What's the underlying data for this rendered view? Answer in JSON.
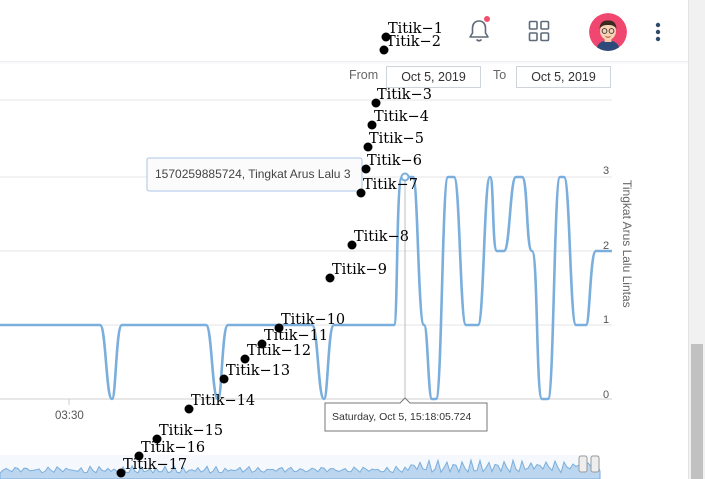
{
  "header": {
    "icons": [
      "bell-icon",
      "grid-icon",
      "avatar",
      "more-vertical-icon"
    ],
    "colors": {
      "notification_dot": "#f0506e",
      "avatar_bg": "#ef476f"
    }
  },
  "date_range": {
    "from_label": "From",
    "from_value": "Oct 5, 2019",
    "to_label": "To",
    "to_value": "Oct 5, 2019"
  },
  "chart": {
    "y_axis_label": "Tingkat Arus Lalu Lintas",
    "y_ticks": [
      "0",
      "1",
      "2",
      "3"
    ],
    "x_tick": "03:30",
    "tooltip_top": "1570259885724, Tingkat Arus Lalu 3",
    "tooltip_bottom": "Saturday, Oct 5, 15:18:05.724",
    "line_color": "#7aaedc"
  },
  "chart_data": {
    "type": "line",
    "series": [
      {
        "name": "Tingkat Arus Lalu Lintas",
        "values": [
          1,
          1,
          0,
          1,
          1,
          0,
          1,
          1,
          0,
          1,
          1,
          0,
          1,
          1,
          0,
          1,
          3,
          3,
          1,
          0,
          3,
          3,
          1,
          3,
          2,
          2,
          3,
          3,
          2,
          2,
          3,
          3,
          0,
          3,
          3,
          1,
          1,
          2,
          2
        ]
      }
    ],
    "ylim": [
      0,
      3
    ]
  },
  "points": [
    {
      "label": "Titik−1"
    },
    {
      "label": "Titik−2"
    },
    {
      "label": "Titik−3"
    },
    {
      "label": "Titik−4"
    },
    {
      "label": "Titik−5"
    },
    {
      "label": "Titik−6"
    },
    {
      "label": "Titik−7"
    },
    {
      "label": "Titik−8"
    },
    {
      "label": "Titik−9"
    },
    {
      "label": "Titik−10"
    },
    {
      "label": "Titik−11"
    },
    {
      "label": "Titik−12"
    },
    {
      "label": "Titik−13"
    },
    {
      "label": "Titik−14"
    },
    {
      "label": "Titik−15"
    },
    {
      "label": "Titik−16"
    },
    {
      "label": "Titik−17"
    }
  ]
}
